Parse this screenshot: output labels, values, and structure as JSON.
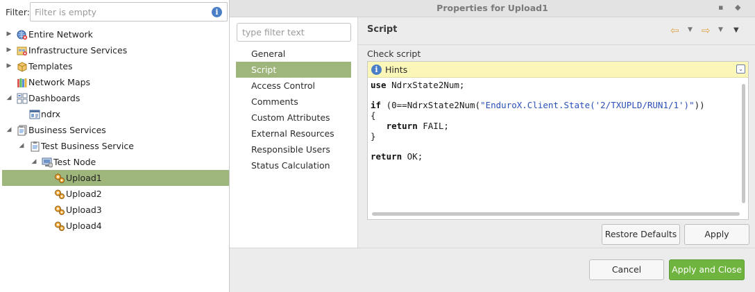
{
  "tree_panel": {
    "filter_label": "Filter:",
    "filter_placeholder": "Filter is empty",
    "nodes": [
      {
        "label": "Entire Network",
        "icon": "network-icon"
      },
      {
        "label": "Infrastructure Services",
        "icon": "infrastructure-icon"
      },
      {
        "label": "Templates",
        "icon": "templates-icon"
      },
      {
        "label": "Network Maps",
        "icon": "network-maps-icon"
      },
      {
        "label": "Dashboards",
        "icon": "dashboards-icon"
      },
      {
        "label": "ndrx",
        "icon": "dashboard-icon"
      },
      {
        "label": "Business Services",
        "icon": "business-services-icon"
      },
      {
        "label": "Test Business Service",
        "icon": "business-service-icon"
      },
      {
        "label": "Test Node",
        "icon": "node-icon"
      },
      {
        "label": "Upload1",
        "icon": "gears-icon",
        "selected": true
      },
      {
        "label": "Upload2",
        "icon": "gears-icon"
      },
      {
        "label": "Upload3",
        "icon": "gears-icon"
      },
      {
        "label": "Upload4",
        "icon": "gears-icon"
      }
    ]
  },
  "dialog": {
    "title": "Properties for Upload1",
    "nav_filter_placeholder": "type filter text",
    "nav_items": [
      {
        "label": "General"
      },
      {
        "label": "Script",
        "selected": true
      },
      {
        "label": "Access Control"
      },
      {
        "label": "Comments"
      },
      {
        "label": "Custom Attributes"
      },
      {
        "label": "External Resources"
      },
      {
        "label": "Responsible Users"
      },
      {
        "label": "Status Calculation"
      }
    ],
    "page_title": "Script",
    "check_script_label": "Check script",
    "hints_label": "Hints",
    "code": {
      "line1_kw": "use",
      "line1_rest": " NdrxState2Num;",
      "line3_kw": "if",
      "line3_a": " (0==NdrxState2Num(",
      "line3_str": "\"EnduroX.Client.State('2/TXUPLD/RUN1/1')\"",
      "line3_b": "))",
      "line4": "{",
      "line5_kw": "return",
      "line5_rest": " FAIL;",
      "line6": "}",
      "line8_kw": "return",
      "line8_rest": " OK;"
    },
    "buttons": {
      "restore_defaults": "Restore Defaults",
      "apply": "Apply",
      "cancel": "Cancel",
      "apply_and_close": "Apply and Close"
    },
    "colors": {
      "selection": "#9eb67b",
      "primary_button": "#6fb43f",
      "hints_background": "#fbf7b9",
      "string_literal": "#2a4fb8"
    }
  }
}
